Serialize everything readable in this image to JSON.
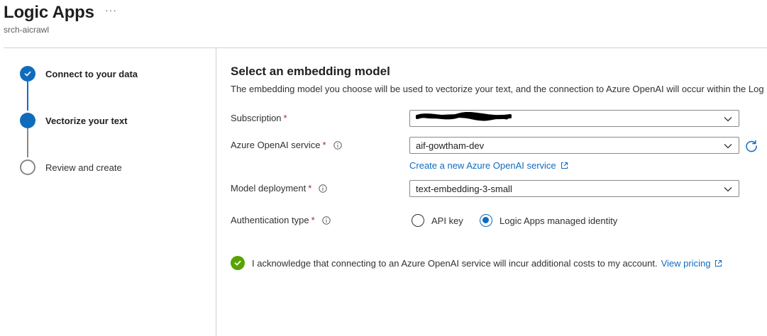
{
  "header": {
    "title": "Logic Apps",
    "subtitle": "srch-aicrawl",
    "more_label": "···"
  },
  "steps": [
    {
      "label": "Connect to your data",
      "state": "done"
    },
    {
      "label": "Vectorize your text",
      "state": "current"
    },
    {
      "label": "Review and create",
      "state": "todo"
    }
  ],
  "main": {
    "title": "Select an embedding model",
    "description": "The embedding model you choose will be used to vectorize your text, and the connection to Azure OpenAI will occur within the Log",
    "fields": {
      "subscription": {
        "label": "Subscription",
        "required": "*",
        "value": ""
      },
      "openai_service": {
        "label": "Azure OpenAI service",
        "required": "*",
        "value": "aif-gowtham-dev"
      },
      "create_link": "Create a new Azure OpenAI service",
      "model_deployment": {
        "label": "Model deployment",
        "required": "*",
        "value": "text-embedding-3-small"
      },
      "auth_type": {
        "label": "Authentication type",
        "required": "*",
        "options": [
          "API key",
          "Logic Apps managed identity"
        ],
        "selected": "Logic Apps managed identity"
      }
    },
    "acknowledge": {
      "text": "I acknowledge that connecting to an Azure OpenAI service will incur additional costs to my account.",
      "link": "View pricing",
      "checked": true
    }
  },
  "colors": {
    "accent": "#0f6cbd",
    "required": "#a4262c",
    "success": "#57a300"
  }
}
